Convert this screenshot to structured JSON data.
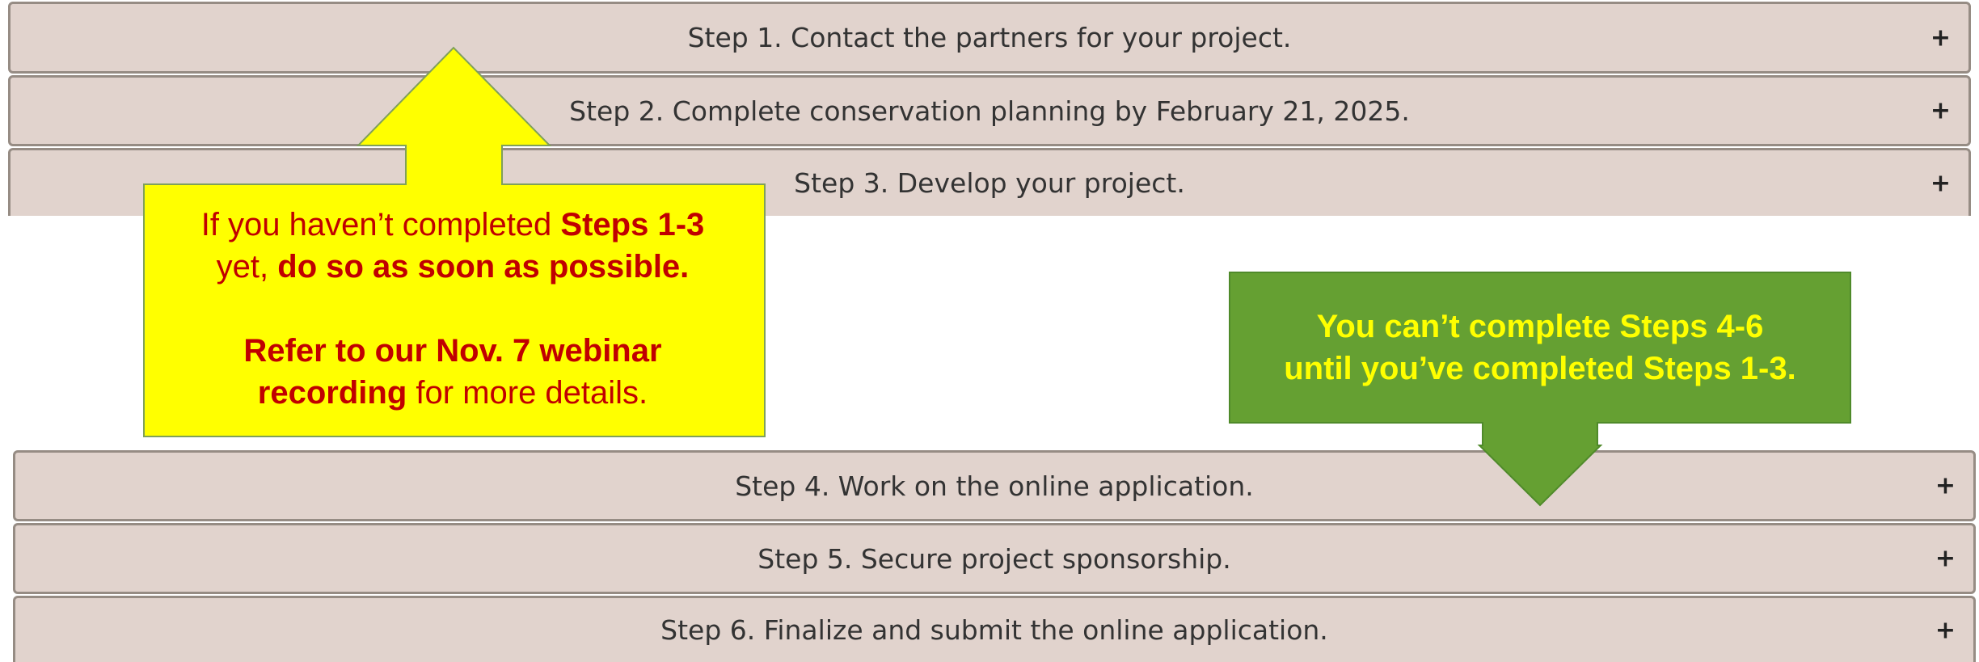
{
  "colors": {
    "row_background": "#e1d3cd",
    "row_border": "#968c84",
    "yellow_callout": "#ffff00",
    "yellow_callout_text": "#c00000",
    "green_callout": "#65a032",
    "green_callout_text": "#ffff00"
  },
  "accordion": {
    "toggle_icon": "plus-icon",
    "steps": [
      {
        "label": "Step 1. Contact the partners for your project.",
        "toggle": "+"
      },
      {
        "label": "Step 2. Complete conservation planning by February 21, 2025.",
        "toggle": "+"
      },
      {
        "label": "Step 3. Develop your project.",
        "toggle": "+"
      },
      {
        "label": "Step 4. Work on the online application.",
        "toggle": "+"
      },
      {
        "label": "Step 5. Secure project sponsorship.",
        "toggle": "+"
      },
      {
        "label": "Step 6. Finalize and submit the online application.",
        "toggle": "+"
      }
    ]
  },
  "callouts": {
    "yellow": {
      "line1_text": "If you haven’t completed ",
      "line1_bold": "Steps 1-3",
      "line2_text": "yet, ",
      "line2_bold": "do so as soon as possible.",
      "line3_bold": "Refer to our Nov. 7 webinar",
      "line4_bold": "recording",
      "line4_text": " for more details."
    },
    "green": {
      "line1": "You can’t complete Steps 4-6",
      "line2": "until you’ve completed Steps 1-3."
    }
  }
}
